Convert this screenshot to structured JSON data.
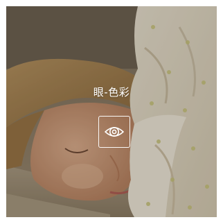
{
  "card": {
    "title": "眼-色彩",
    "icon": "eye-icon"
  },
  "colors": {
    "overlay_text": "#ffffff",
    "icon_stroke": "#ffffff"
  }
}
